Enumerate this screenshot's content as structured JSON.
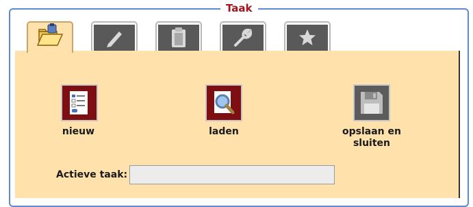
{
  "panel": {
    "legend": "Taak"
  },
  "tabs": [
    {
      "icon": "folder-open-icon",
      "active": true
    },
    {
      "icon": "pencil-icon",
      "active": false
    },
    {
      "icon": "clipboard-icon",
      "active": false
    },
    {
      "icon": "wrench-icon",
      "active": false
    },
    {
      "icon": "star-icon",
      "active": false
    }
  ],
  "actions": {
    "new": {
      "label": "nieuw",
      "icon": "new-form-icon"
    },
    "load": {
      "label": "laden",
      "icon": "magnifier-document-icon"
    },
    "save": {
      "label_line1": "opslaan en",
      "label_line2": "sluiten",
      "icon": "floppy-disk-icon"
    }
  },
  "active_task": {
    "label": "Actieve taak:",
    "value": "",
    "placeholder": ""
  },
  "colors": {
    "frame": "#5d88d6",
    "legend": "#a0161f",
    "content_bg": "#ffe1ab",
    "icon_red": "#7d0f12",
    "icon_grey": "#5c5c5c",
    "tab_grey": "#595959"
  }
}
